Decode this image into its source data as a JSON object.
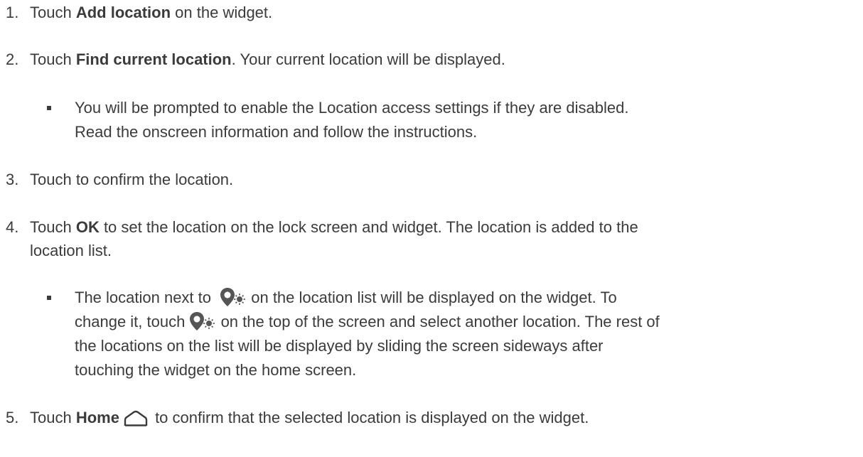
{
  "steps": [
    {
      "number": "1.",
      "pre": "Touch ",
      "bold": "Add location",
      "post": " on the widget."
    },
    {
      "number": "2.",
      "pre": "Touch ",
      "bold": "Find current location",
      "post": ". Your current location will be displayed."
    },
    {
      "bullet_line1": "You will be prompted to enable the Location access settings if they are disabled.",
      "bullet_line2": "Read the onscreen information and follow the instructions."
    },
    {
      "number": "3.",
      "text": "Touch to confirm the location."
    },
    {
      "number": "4.",
      "pre": "Touch ",
      "bold": "OK",
      "post": " to set the location on the lock screen and widget. The location is added to the",
      "line2": "location list."
    },
    {
      "bullet_a_pre": "The location next to ",
      "bullet_a_post": " on the location list will be displayed on the widget. To",
      "bullet_b_pre": "change it, touch ",
      "bullet_b_post": " on the top of the screen and select another location. The rest of",
      "bullet_c": "the locations on the list will be displayed by sliding the screen sideways after",
      "bullet_d": "touching the widget on the home screen."
    },
    {
      "number": "5.",
      "pre": "Touch ",
      "bold": "Home",
      "post": " to confirm that the selected location is displayed on the widget."
    }
  ],
  "icons": {
    "location_weather": "location-weather-icon",
    "home": "home-icon"
  },
  "colors": {
    "text": "#3b3b3b",
    "icon": "#555555"
  }
}
